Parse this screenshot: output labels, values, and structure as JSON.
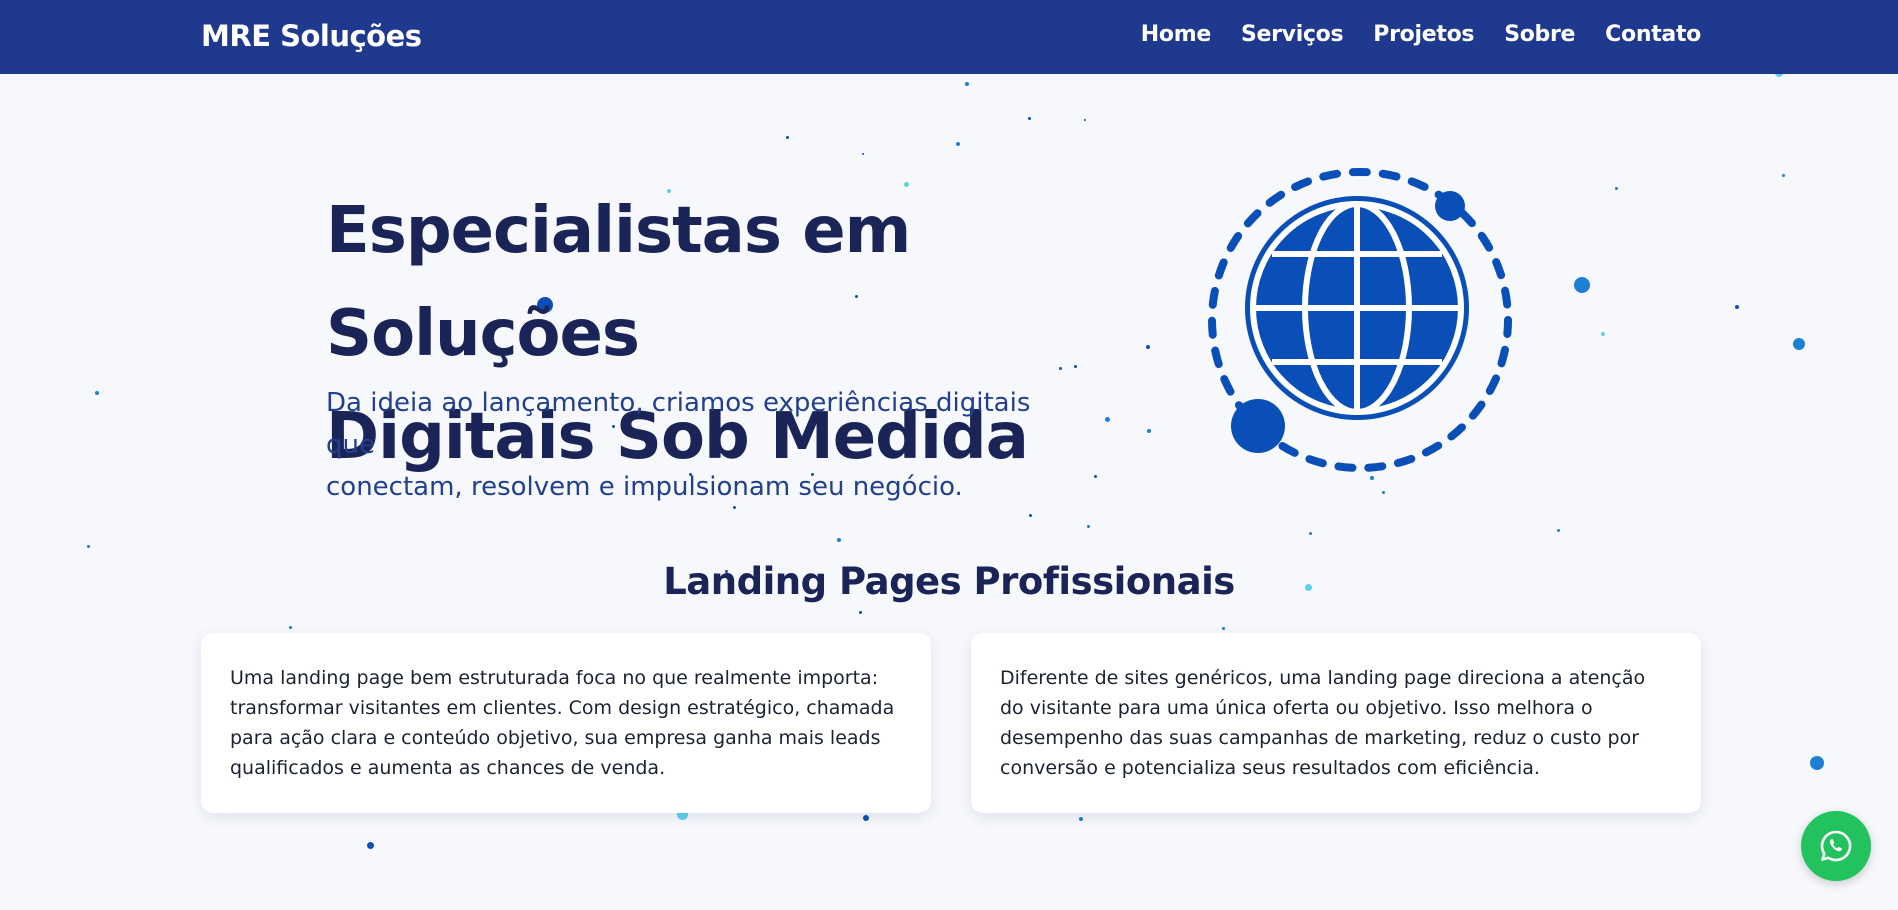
{
  "header": {
    "brand": "MRE Soluções",
    "nav": [
      "Home",
      "Serviços",
      "Projetos",
      "Sobre",
      "Contato"
    ]
  },
  "hero": {
    "title_line1": "Especialistas em Soluções",
    "title_line2": "Digitais Sob Medida",
    "subtitle_line1": "Da ideia ao lançamento, criamos experiências digitais que",
    "subtitle_line2": "conectam, resolvem e impulsionam seu negócio.",
    "illustration_icon": "globe-icon"
  },
  "section": {
    "title": "Landing Pages Profissionais",
    "cards": [
      "Uma landing page bem estruturada foca no que realmente importa: transformar visitantes em clientes. Com design estratégico, chamada para ação clara e conteúdo objetivo, sua empresa ganha mais leads qualificados e aumenta as chances de venda.",
      "Diferente de sites genéricos, uma landing page direciona a atenção do visitante para uma única oferta ou objetivo. Isso melhora o desempenho das suas campanhas de marketing, reduz o custo por conversão e potencializa seus resultados com eficiência."
    ]
  },
  "floating_button": {
    "icon": "whatsapp-icon"
  },
  "colors": {
    "header_bg": "#1e398d",
    "title": "#1b2457",
    "subtitle": "#22408f",
    "globe": "#0a4fb8",
    "whatsapp": "#22c35e"
  }
}
